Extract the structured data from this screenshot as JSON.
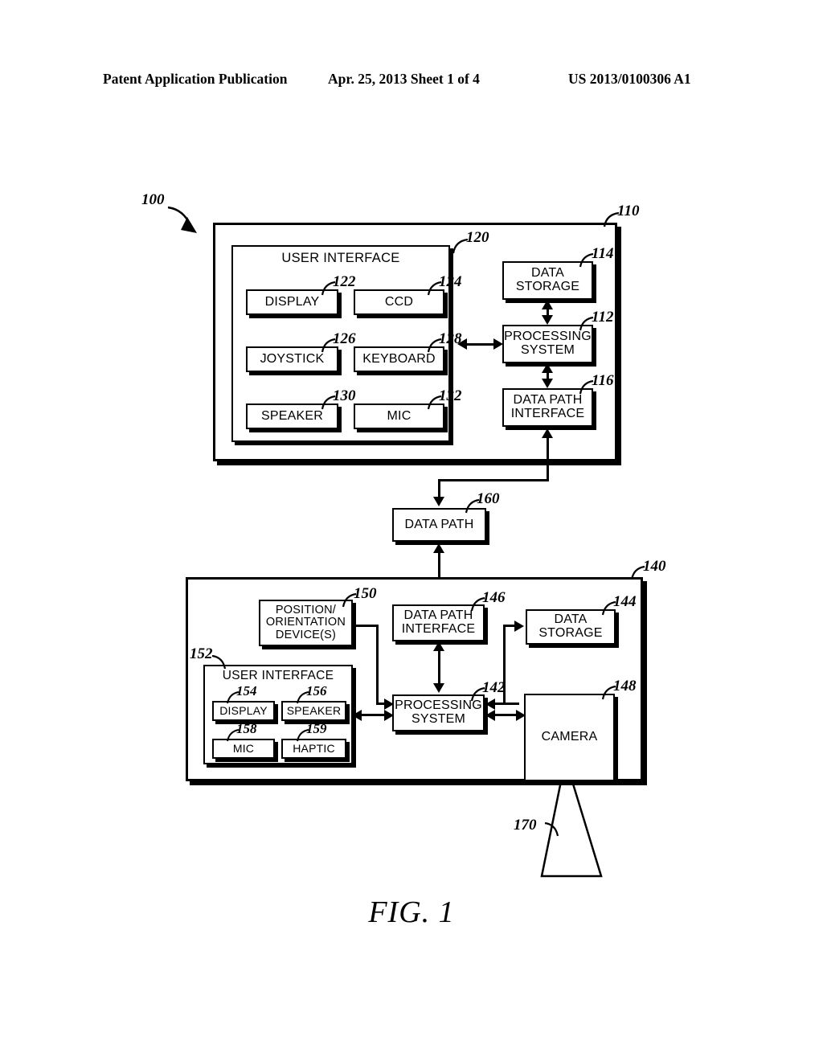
{
  "header": {
    "publication": "Patent Application Publication",
    "date_sheet": "Apr. 25, 2013  Sheet 1 of 4",
    "patent_number": "US 2013/0100306 A1"
  },
  "figure": {
    "caption": "FIG. 1",
    "system_ref": "100"
  },
  "upper_system": {
    "ref": "110",
    "user_interface": {
      "ref": "120",
      "title": "USER INTERFACE",
      "components": [
        {
          "ref": "122",
          "label": "DISPLAY"
        },
        {
          "ref": "124",
          "label": "CCD"
        },
        {
          "ref": "126",
          "label": "JOYSTICK"
        },
        {
          "ref": "128",
          "label": "KEYBOARD"
        },
        {
          "ref": "130",
          "label": "SPEAKER"
        },
        {
          "ref": "132",
          "label": "MIC"
        }
      ]
    },
    "modules": [
      {
        "ref": "114",
        "label": "DATA\nSTORAGE"
      },
      {
        "ref": "112",
        "label": "PROCESSING\nSYSTEM"
      },
      {
        "ref": "116",
        "label": "DATA PATH\nINTERFACE"
      }
    ]
  },
  "data_path": {
    "ref": "160",
    "label": "DATA PATH"
  },
  "lower_system": {
    "ref": "140",
    "position_device": {
      "ref": "150",
      "label": "POSITION/\nORIENTATION\nDEVICE(S)"
    },
    "user_interface": {
      "ref": "152",
      "title": "USER INTERFACE",
      "components": [
        {
          "ref": "154",
          "label": "DISPLAY"
        },
        {
          "ref": "156",
          "label": "SPEAKER"
        },
        {
          "ref": "158",
          "label": "MIC"
        },
        {
          "ref": "159",
          "label": "HAPTIC"
        }
      ]
    },
    "modules": [
      {
        "ref": "146",
        "label": "DATA PATH\nINTERFACE"
      },
      {
        "ref": "144",
        "label": "DATA\nSTORAGE"
      },
      {
        "ref": "142",
        "label": "PROCESSING\nSYSTEM"
      },
      {
        "ref": "148",
        "label": "CAMERA"
      }
    ],
    "field_of_view": {
      "ref": "170"
    }
  },
  "colors": {
    "ink": "#000000",
    "paper": "#ffffff"
  }
}
